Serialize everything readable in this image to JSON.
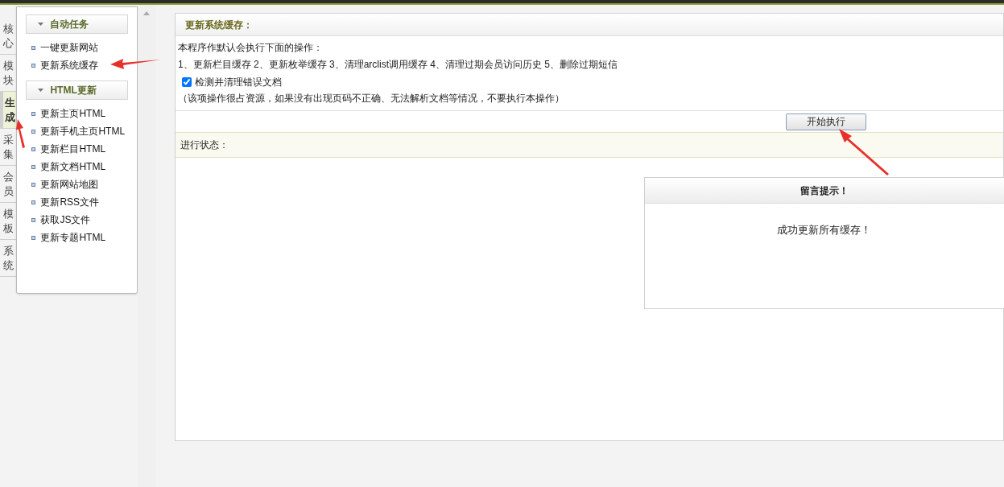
{
  "side_tabs": [
    {
      "label": "核心",
      "selected": false
    },
    {
      "label": "模块",
      "selected": false
    },
    {
      "label": "生成",
      "selected": true
    },
    {
      "label": "采集",
      "selected": false
    },
    {
      "label": "会员",
      "selected": false
    },
    {
      "label": "模板",
      "selected": false
    },
    {
      "label": "系统",
      "selected": false
    }
  ],
  "sidebar": {
    "sections": [
      {
        "title": "自动任务",
        "items": [
          "一键更新网站",
          "更新系统缓存"
        ]
      },
      {
        "title": "HTML更新",
        "items": [
          "更新主页HTML",
          "更新手机主页HTML",
          "更新栏目HTML",
          "更新文档HTML",
          "更新网站地图",
          "更新RSS文件",
          "获取JS文件",
          "更新专题HTML"
        ]
      }
    ]
  },
  "panel": {
    "title": "更新系统缓存：",
    "intro": "本程序作默认会执行下面的操作：",
    "operations": "1、更新栏目缓存 2、更新枚举缓存 3、清理arclist调用缓存 4、清理过期会员访问历史 5、删除过期短信",
    "checkbox": {
      "label": "检测并清理错误文档",
      "checked": true
    },
    "note": "（该项操作很占资源，如果没有出现页码不正确、无法解析文档等情况，不要执行本操作）",
    "button": "开始执行",
    "status_label": "进行状态："
  },
  "message_box": {
    "title": "留言提示！",
    "message": "成功更新所有缓存！"
  }
}
